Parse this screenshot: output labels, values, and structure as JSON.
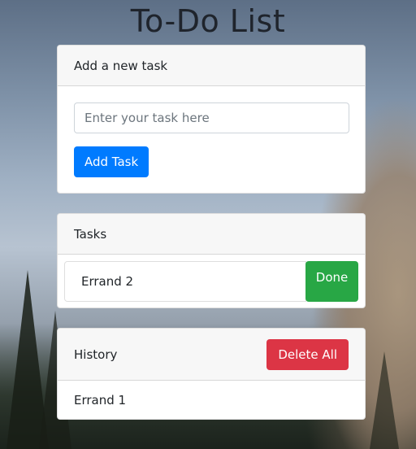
{
  "page": {
    "title": "To-Do List"
  },
  "add_task": {
    "header": "Add a new task",
    "input_placeholder": "Enter your task here",
    "input_value": "",
    "button_label": "Add Task"
  },
  "tasks": {
    "header": "Tasks",
    "items": [
      {
        "text": "Errand 2",
        "done_label": "Done"
      }
    ]
  },
  "history": {
    "header": "History",
    "delete_all_label": "Delete All",
    "items": [
      {
        "text": "Errand 1"
      }
    ]
  },
  "colors": {
    "primary": "#007bff",
    "success": "#28a745",
    "danger": "#dc3545",
    "card_header_bg": "#f7f7f7",
    "title_text": "#1f242c"
  }
}
